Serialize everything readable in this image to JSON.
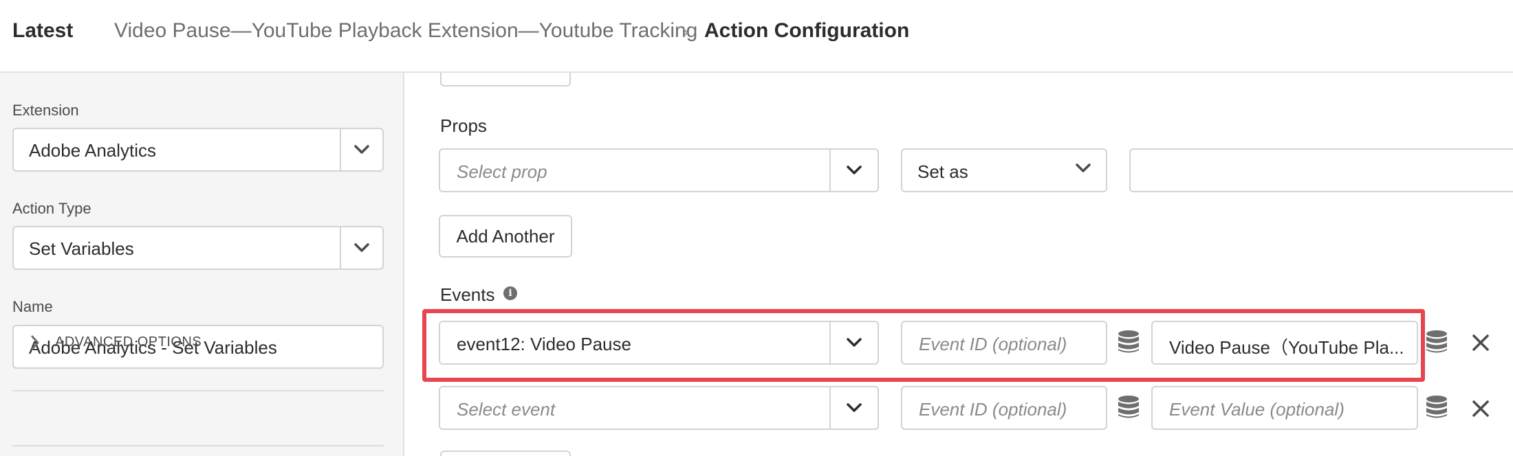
{
  "header": {
    "latest": "Latest",
    "breadcrumb": "Video Pause—YouTube Playback Extension—Youtube Tracking",
    "separator": "›",
    "current": "Action Configuration"
  },
  "sidebar": {
    "extension_label": "Extension",
    "extension_value": "Adobe Analytics",
    "action_type_label": "Action Type",
    "action_type_value": "Set Variables",
    "name_label": "Name",
    "name_value": "Adobe Analytics - Set Variables",
    "advanced_label": "ADVANCED OPTIONS"
  },
  "props": {
    "label": "Props",
    "select_placeholder": "Select prop",
    "set_as": "Set as",
    "add_another": "Add Another"
  },
  "events": {
    "label": "Events",
    "info_icon": "i",
    "rows": [
      {
        "event": "event12: Video Pause",
        "event_placeholder": "",
        "event_id_placeholder": "Event ID (optional)",
        "value": "Video Pause（YouTube Pla...",
        "value_placeholder": ""
      },
      {
        "event": "",
        "event_placeholder": "Select event",
        "event_id_placeholder": "Event ID (optional)",
        "value": "",
        "value_placeholder": "Event Value (optional)"
      }
    ]
  },
  "colors": {
    "highlight": "#e8464e",
    "sidebar_bg": "#f5f5f5",
    "border": "#d3d3d3"
  },
  "icons": {
    "chevron": "chevron-down-icon",
    "data_element": "database-icon",
    "close": "close-icon",
    "expand": "chevron-right-icon"
  }
}
